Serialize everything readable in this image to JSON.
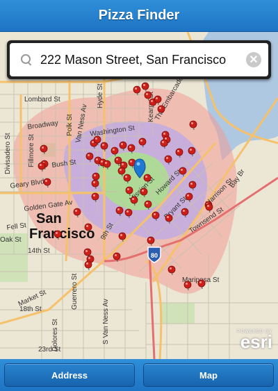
{
  "header": {
    "title": "Pizza Finder"
  },
  "search": {
    "value": "222 Mason Street, San Francisco",
    "clear_icon": "clear-icon",
    "search_icon": "search-icon"
  },
  "map": {
    "city_label_1": "San",
    "city_label_2": "Francisco",
    "freeway_label": "80",
    "streets": {
      "lombard": "Lombard St",
      "broadway": "Broadway",
      "washington": "Washington St",
      "bush": "Bush St",
      "geary": "Geary Blvd",
      "golden_gate": "Golden Gate Av",
      "fell": "Fell St",
      "oak": "Oak St",
      "fourteenth": "14th St",
      "market": "Market St",
      "eighteenth": "18th St",
      "twentythird": "23rd St",
      "embarcadero": "The Embarcadero",
      "baybr": "Bay Br",
      "harrison": "Harrison St",
      "townsend": "Townsend St",
      "bryant": "Bryant St",
      "howard": "Howard St",
      "mission": "Mission St",
      "ninth": "9th St",
      "mariposa": "Mariposa St",
      "divisadero": "Divisadero St",
      "hyde": "Hyde St",
      "vanness": "Van Ness Av",
      "polk": "Polk St",
      "kearny": "Kearny St",
      "guerrero": "Guerrero St",
      "dolores": "Dolores St",
      "svanness": "S Van Ness Av",
      "fillmore": "Fillmore St"
    }
  },
  "attribution": {
    "powered_by": "POWERED BY",
    "brand": "esri"
  },
  "tabs": {
    "address": "Address",
    "map": "Map"
  },
  "colors": {
    "header": "#1e74c4",
    "pin": "#cc1f1a",
    "location": "#1f78d1",
    "zone_inner": "#a9e08a",
    "zone_mid": "#b9a9ea",
    "zone_outer": "#f29b93"
  }
}
